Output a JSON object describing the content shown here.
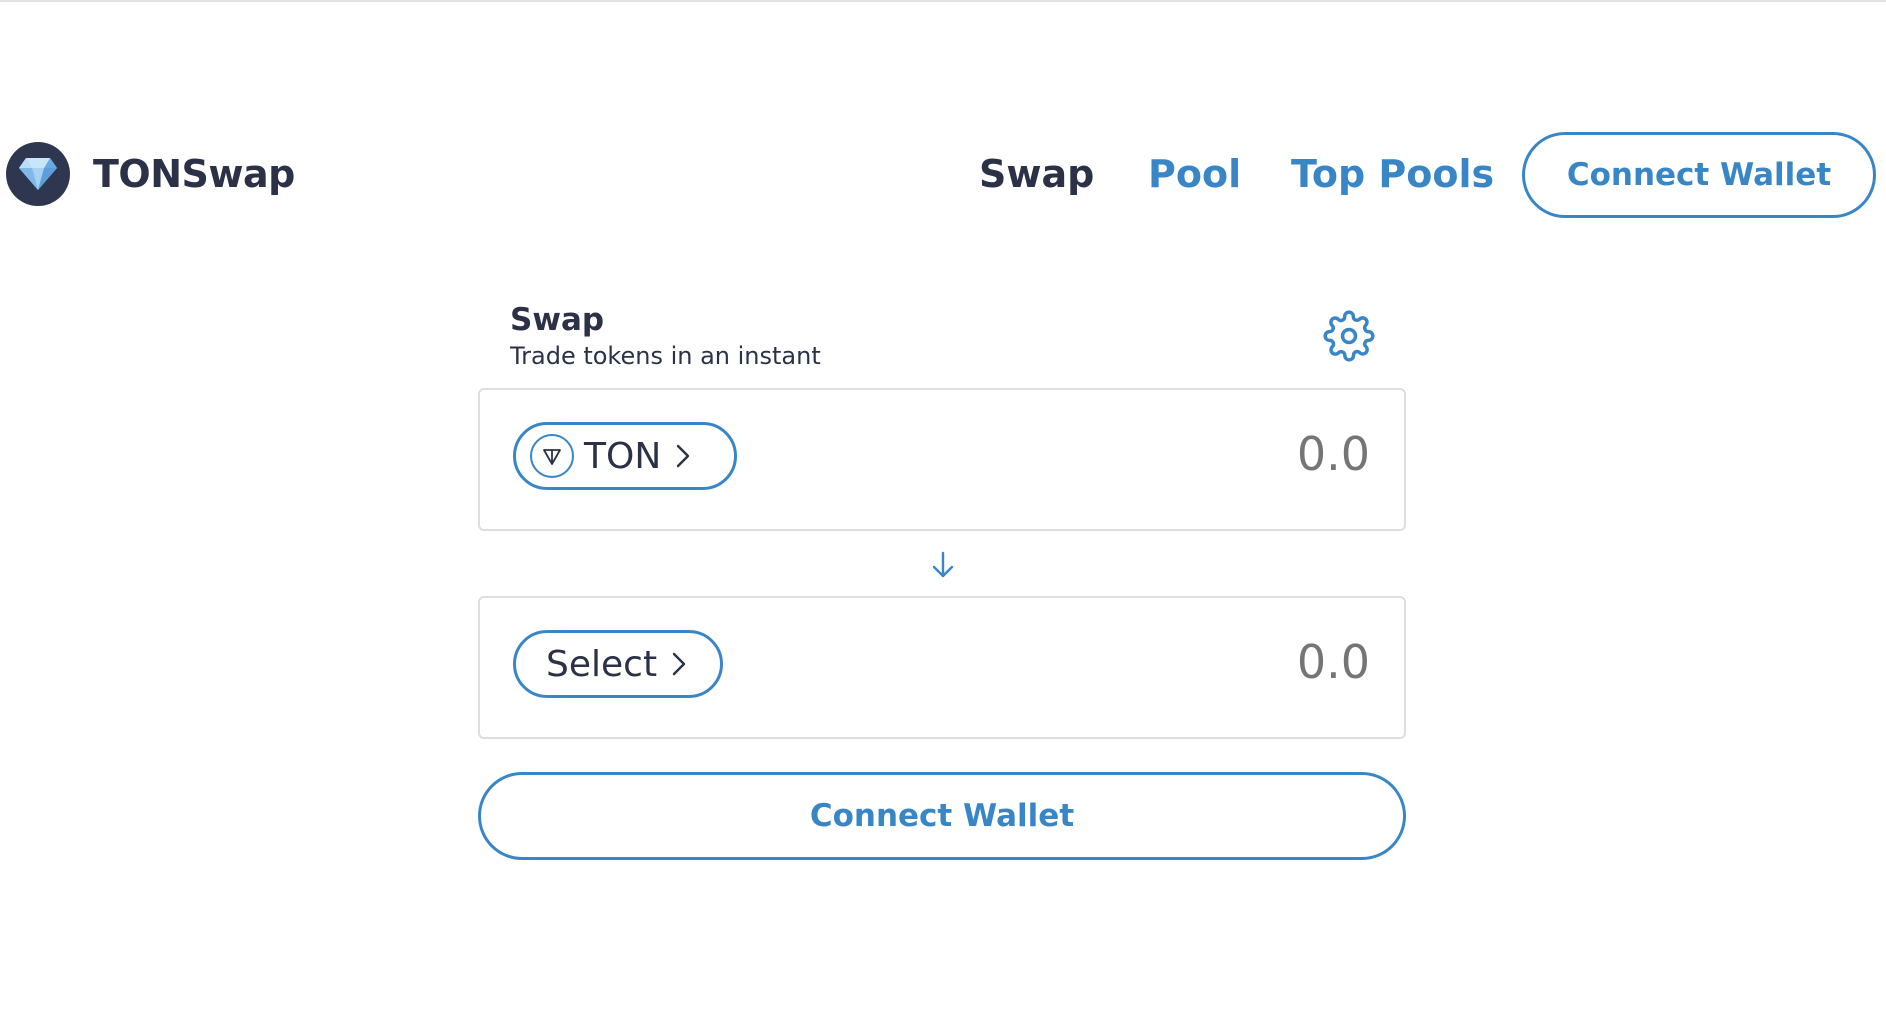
{
  "header": {
    "brand": "TONSwap",
    "logo_icon": "diamond-icon",
    "nav": {
      "swap": "Swap",
      "pool": "Pool",
      "top_pools": "Top Pools"
    },
    "connect_label": "Connect Wallet"
  },
  "swap": {
    "title": "Swap",
    "subtitle": "Trade tokens in an instant",
    "settings_icon": "gear-icon",
    "from": {
      "token": "TON",
      "token_icon": "ton-icon",
      "amount_placeholder": "0.0"
    },
    "direction_icon": "arrow-down-icon",
    "to": {
      "token": "Select",
      "amount_placeholder": "0.0"
    },
    "connect_label": "Connect Wallet"
  },
  "colors": {
    "accent": "#3986c7",
    "text_dark": "#2b3147",
    "logo_bg": "#2f3650",
    "amount_text": "#707070",
    "border": "#dedede"
  }
}
